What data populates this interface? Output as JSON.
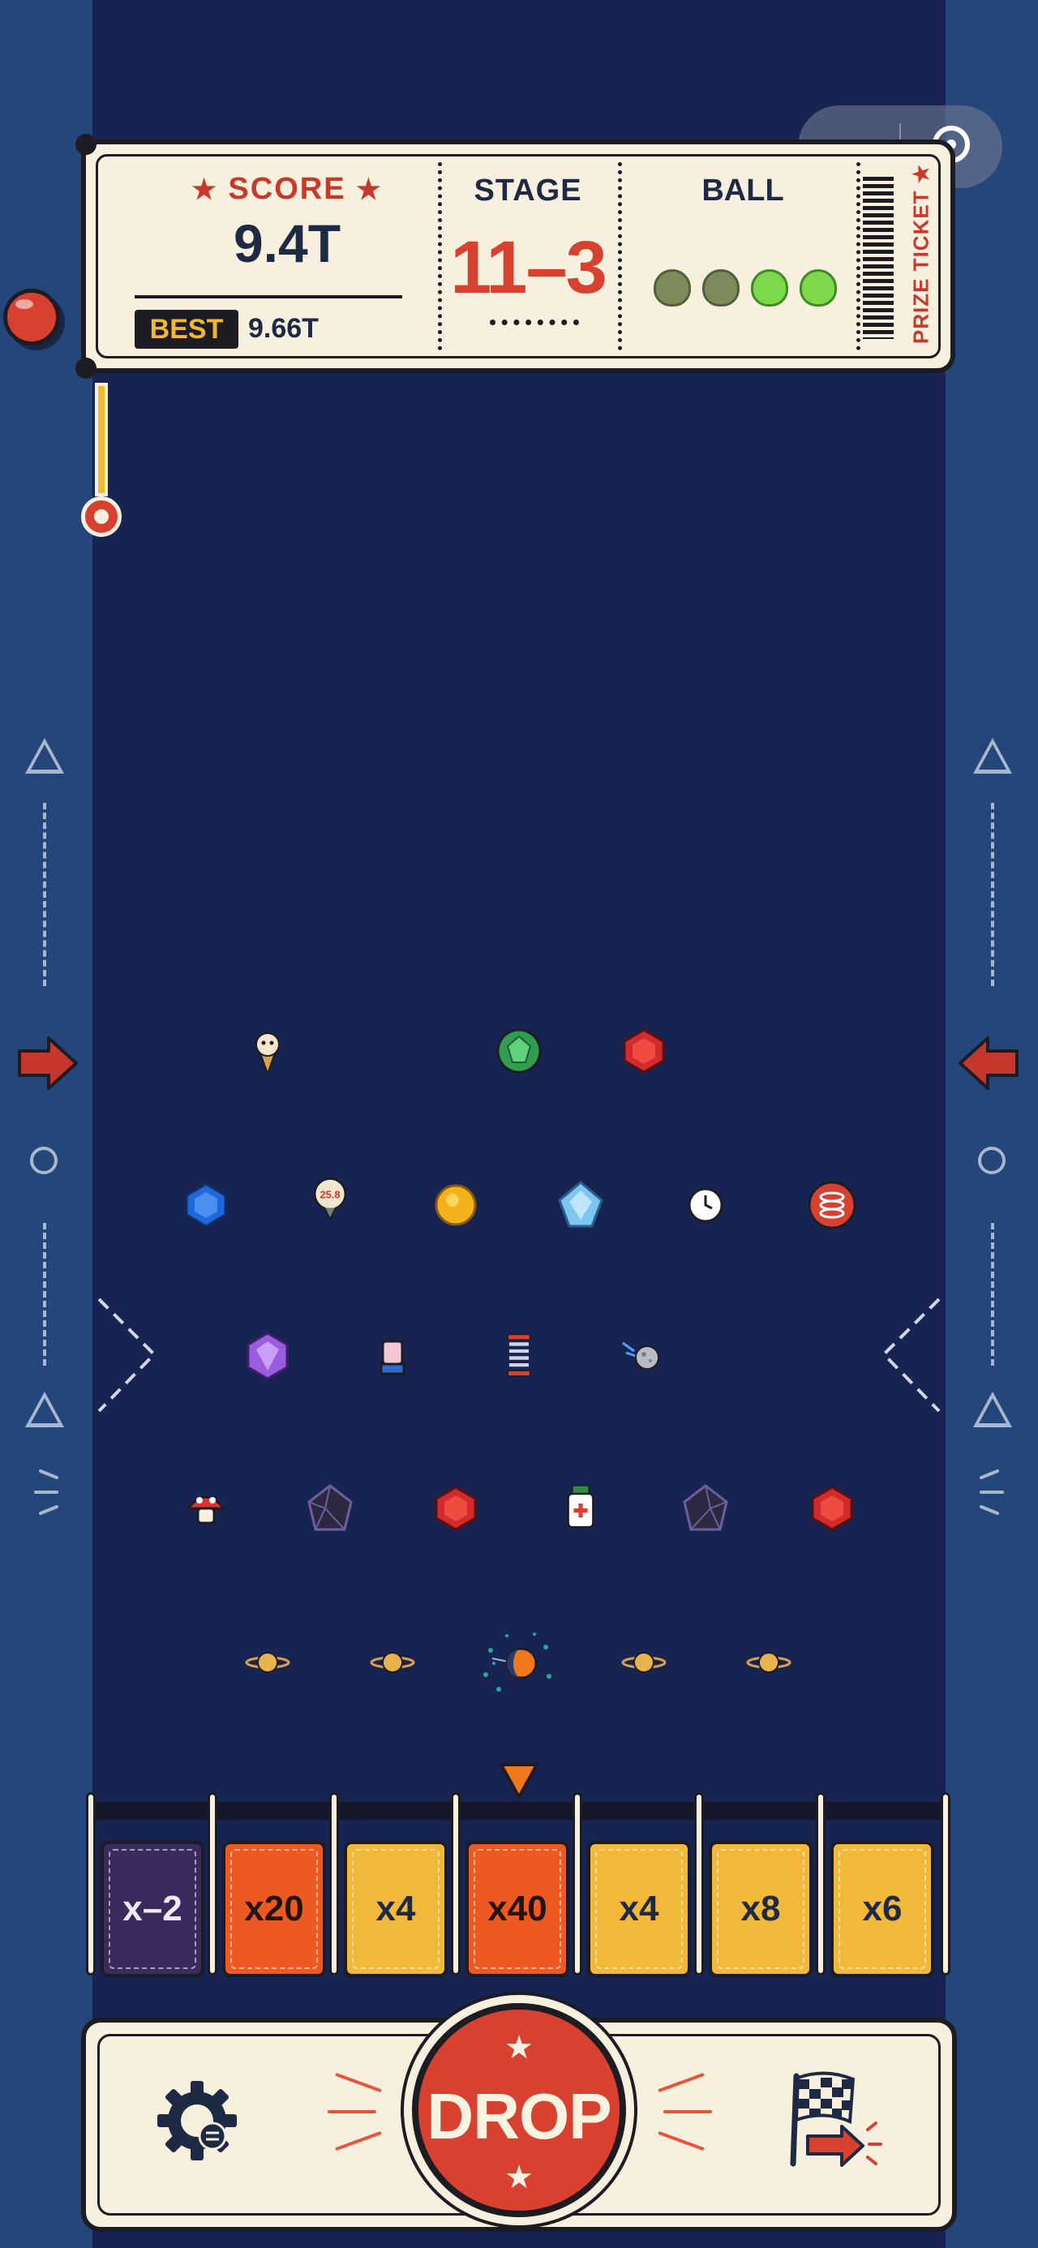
{
  "scoreboard": {
    "score_label": "SCORE",
    "score": "9.4T",
    "best_label": "BEST",
    "best": "9.66T",
    "stage_label": "STAGE",
    "stage": "11–3",
    "ball_label": "BALL",
    "balls": [
      {
        "state": "used"
      },
      {
        "state": "used"
      },
      {
        "state": "remaining"
      },
      {
        "state": "remaining"
      }
    ],
    "prize_ticket": "PRIZE TICKET ★"
  },
  "thermometer": {
    "level": 0.2
  },
  "pegs": [
    {
      "name": "ice-cream-icon",
      "row": 1
    },
    {
      "name": "green-gem-icon",
      "row": 1
    },
    {
      "name": "red-gem-icon",
      "row": 1
    },
    {
      "name": "blue-gem-icon",
      "row": 2
    },
    {
      "name": "price-tag-icon",
      "row": 2,
      "text": "25.8"
    },
    {
      "name": "gold-coin-icon",
      "row": 2
    },
    {
      "name": "diamond-icon",
      "row": 2
    },
    {
      "name": "clock-icon",
      "row": 2
    },
    {
      "name": "spring-icon",
      "row": 2
    },
    {
      "name": "purple-gem-icon",
      "row": 3
    },
    {
      "name": "blender-icon",
      "row": 3
    },
    {
      "name": "spring-icon",
      "row": 3
    },
    {
      "name": "meteor-icon",
      "row": 3
    },
    {
      "name": "mushroom-icon",
      "row": 4
    },
    {
      "name": "dark-crystal-icon",
      "row": 4
    },
    {
      "name": "red-gem-icon",
      "row": 4
    },
    {
      "name": "medicine-bottle-icon",
      "row": 4
    },
    {
      "name": "dark-crystal-icon",
      "row": 4
    },
    {
      "name": "red-gem-icon",
      "row": 4
    },
    {
      "name": "planet-icon",
      "row": 5
    },
    {
      "name": "planet-icon",
      "row": 5
    },
    {
      "name": "comet-ball-icon",
      "row": 5
    },
    {
      "name": "planet-icon",
      "row": 5
    },
    {
      "name": "planet-icon",
      "row": 5
    }
  ],
  "slots": [
    {
      "label": "x–2",
      "color": "#3b2a5e"
    },
    {
      "label": "x20",
      "color": "#ec5a22"
    },
    {
      "label": "x4",
      "color": "#f2b83a"
    },
    {
      "label": "x40",
      "color": "#ec5a22"
    },
    {
      "label": "x4",
      "color": "#f2b83a"
    },
    {
      "label": "x8",
      "color": "#f2b83a"
    },
    {
      "label": "x6",
      "color": "#f2b83a"
    }
  ],
  "controls": {
    "drop_label": "DROP",
    "settings_icon": "gear-icon",
    "finish_icon": "checkered-flag-icon"
  },
  "colors": {
    "accent_red": "#d8412f",
    "score_yellow": "#f2b830",
    "board": "#172451",
    "paper": "#f7f0df"
  }
}
